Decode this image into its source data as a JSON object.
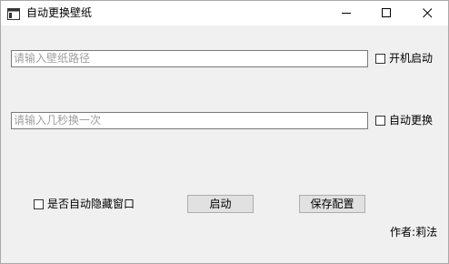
{
  "window": {
    "title": "自动更换壁纸",
    "icon": "app-window-icon",
    "controls": {
      "minimize_icon": "minimize-icon",
      "maximize_icon": "maximize-icon",
      "close_icon": "close-icon"
    }
  },
  "wallpaper_path": {
    "value": "",
    "placeholder": "请输入壁纸路径"
  },
  "startup_checkbox": {
    "label": "开机启动",
    "checked": false
  },
  "interval_input": {
    "value": "",
    "placeholder": "请输入几秒换一次"
  },
  "auto_change_checkbox": {
    "label": "自动更换",
    "checked": false
  },
  "hide_window_checkbox": {
    "label": "是否自动隐藏窗口",
    "checked": false
  },
  "buttons": {
    "start_label": "启动",
    "save_label": "保存配置"
  },
  "author": {
    "prefix": "作者",
    "separator": ":",
    "name": "莉法"
  },
  "colors": {
    "window_bg": "#f0f0f0",
    "titlebar_bg": "#ffffff",
    "button_bg": "#e1e1e1",
    "placeholder_text": "#a0a0a0"
  }
}
